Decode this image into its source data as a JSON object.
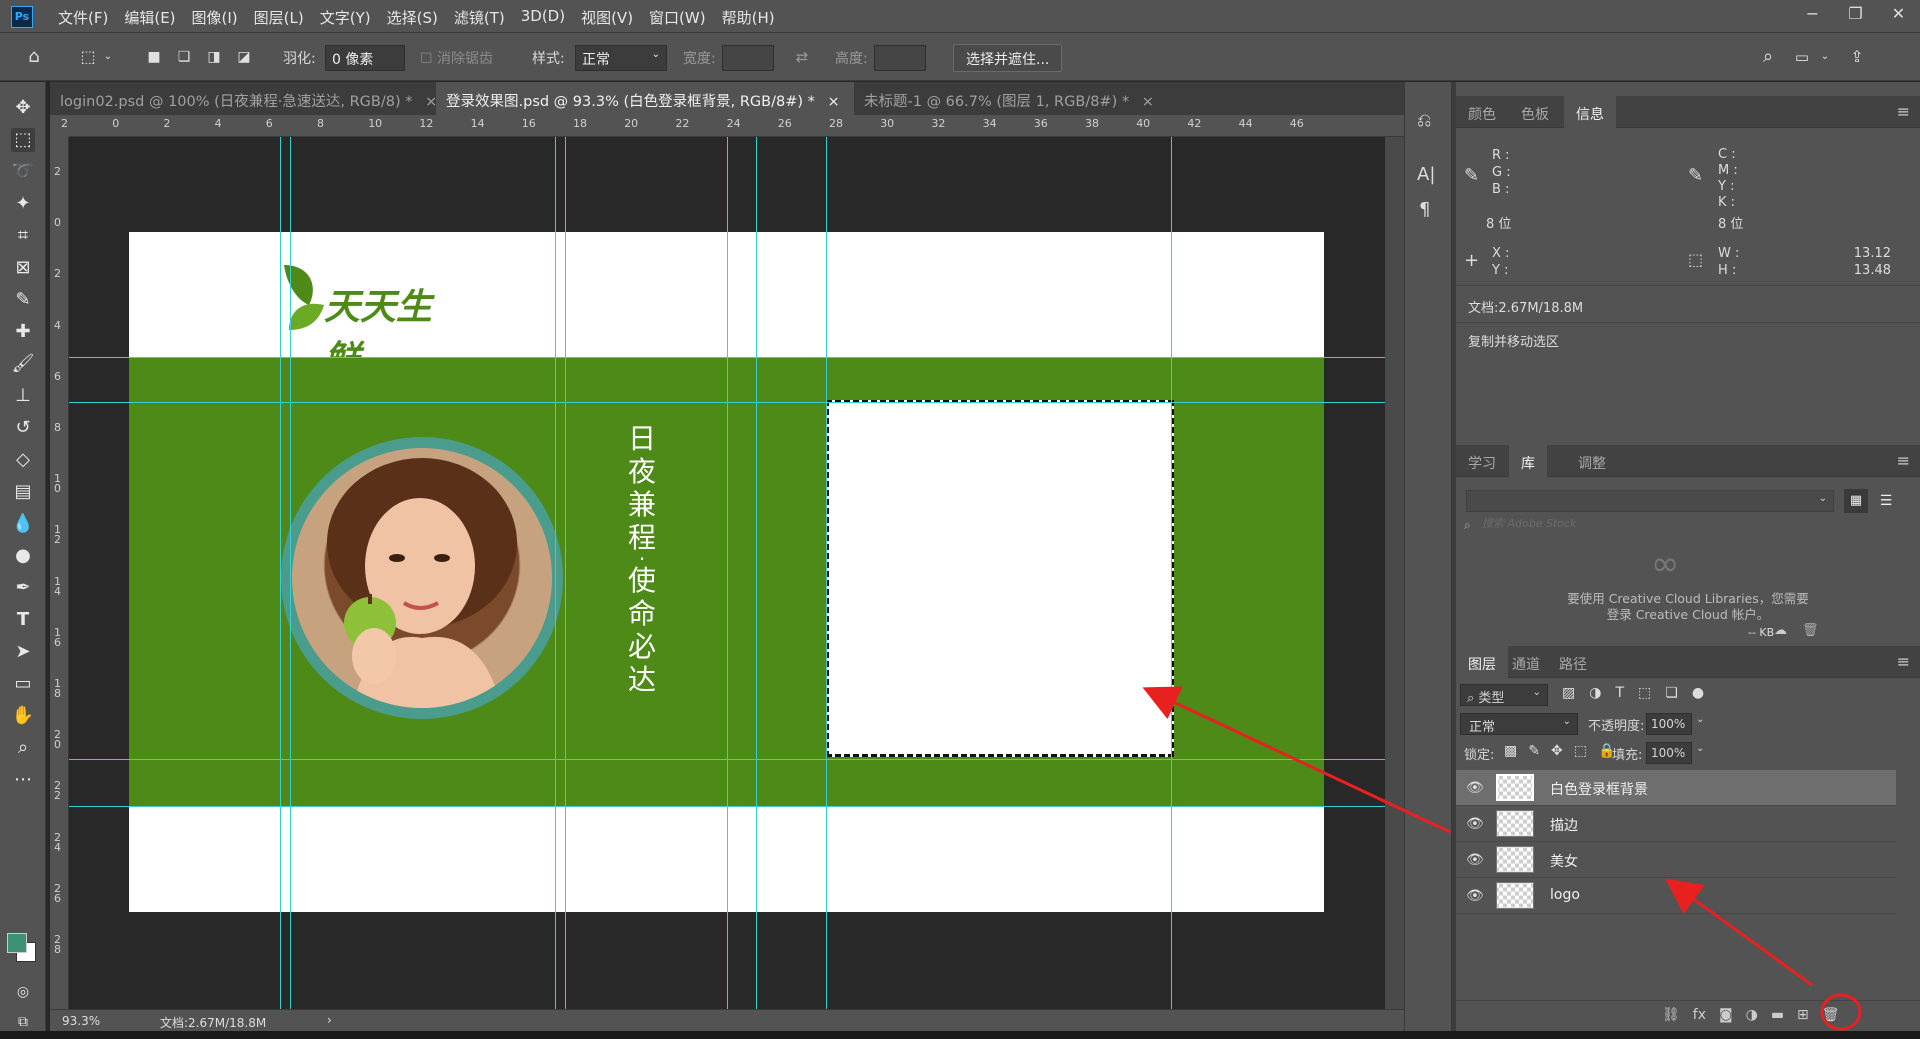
{
  "app": {
    "icon": "Ps"
  },
  "menu": [
    "文件(F)",
    "编辑(E)",
    "图像(I)",
    "图层(L)",
    "文字(Y)",
    "选择(S)",
    "滤镜(T)",
    "3D(D)",
    "视图(V)",
    "窗口(W)",
    "帮助(H)"
  ],
  "options": {
    "feather_label": "羽化:",
    "feather_value": "0 像素",
    "antialias_label": "消除锯齿",
    "style_label": "样式:",
    "style_value": "正常",
    "width_label": "宽度:",
    "height_label": "高度:",
    "select_mask_button": "选择并遮住..."
  },
  "tabs": [
    {
      "label": "login02.psd @ 100% (日夜兼程·急速送达, RGB/8) *",
      "close": "×"
    },
    {
      "label": "登录效果图.psd @ 93.3% (白色登录框背景, RGB/8#) *",
      "close": "×"
    },
    {
      "label": "未标题-1 @ 66.7% (图层 1, RGB/8#) *",
      "close": "×"
    }
  ],
  "ruler_h": [
    "2",
    "0",
    "2",
    "4",
    "6",
    "8",
    "10",
    "12",
    "14",
    "16",
    "18",
    "20",
    "22",
    "24",
    "26",
    "28",
    "30",
    "32",
    "34",
    "36",
    "38",
    "40",
    "42",
    "44",
    "46"
  ],
  "ruler_v": [
    "2",
    "0",
    "2",
    "4",
    "6",
    "8",
    "10",
    "12",
    "14",
    "16",
    "18",
    "20",
    "22",
    "24",
    "26",
    "28"
  ],
  "canvas": {
    "logo_text": "天天生鲜",
    "slogan_chars": [
      "日",
      "夜",
      "兼",
      "程",
      "·",
      "使",
      "命",
      "必",
      "达"
    ],
    "colors": {
      "green": "#4e8a18",
      "white": "#ffffff",
      "ring": "#4a9c8c",
      "guide": "#37d0d0"
    }
  },
  "status": {
    "zoom": "93.3%",
    "doc": "文档:2.67M/18.8M",
    "arrow": "›"
  },
  "panels": {
    "top_tabs": [
      "颜色",
      "色板",
      "信息"
    ],
    "info": {
      "rgb_labels": [
        "R :",
        "G :",
        "B :"
      ],
      "cmyk_labels": [
        "C :",
        "M :",
        "Y :",
        "K :"
      ],
      "bits_left": "8 位",
      "bits_right": "8 位",
      "xy_labels": [
        "X :",
        "Y :"
      ],
      "wh_labels": [
        "W :",
        "H :"
      ],
      "w_value": "13.12",
      "h_value": "13.48",
      "doc": "文档:2.67M/18.8M",
      "hint": "复制并移动选区"
    },
    "mid_tabs": [
      "学习",
      "库",
      "调整"
    ],
    "library": {
      "search_placeholder": "搜索 Adobe Stock",
      "msg1": "要使用 Creative Cloud Libraries，您需要",
      "msg2": "登录 Creative Cloud 帐户。",
      "kb": "-- KB"
    },
    "layer_tabs": [
      "图层",
      "通道",
      "路径"
    ],
    "layers": {
      "filter": "类型",
      "blend": "正常",
      "opacity_label": "不透明度:",
      "opacity": "100%",
      "lock_label": "锁定:",
      "fill_label": "填充:",
      "fill": "100%",
      "items": [
        "白色登录框背景",
        "描边",
        "美女",
        "logo"
      ],
      "fx": "fx"
    }
  }
}
